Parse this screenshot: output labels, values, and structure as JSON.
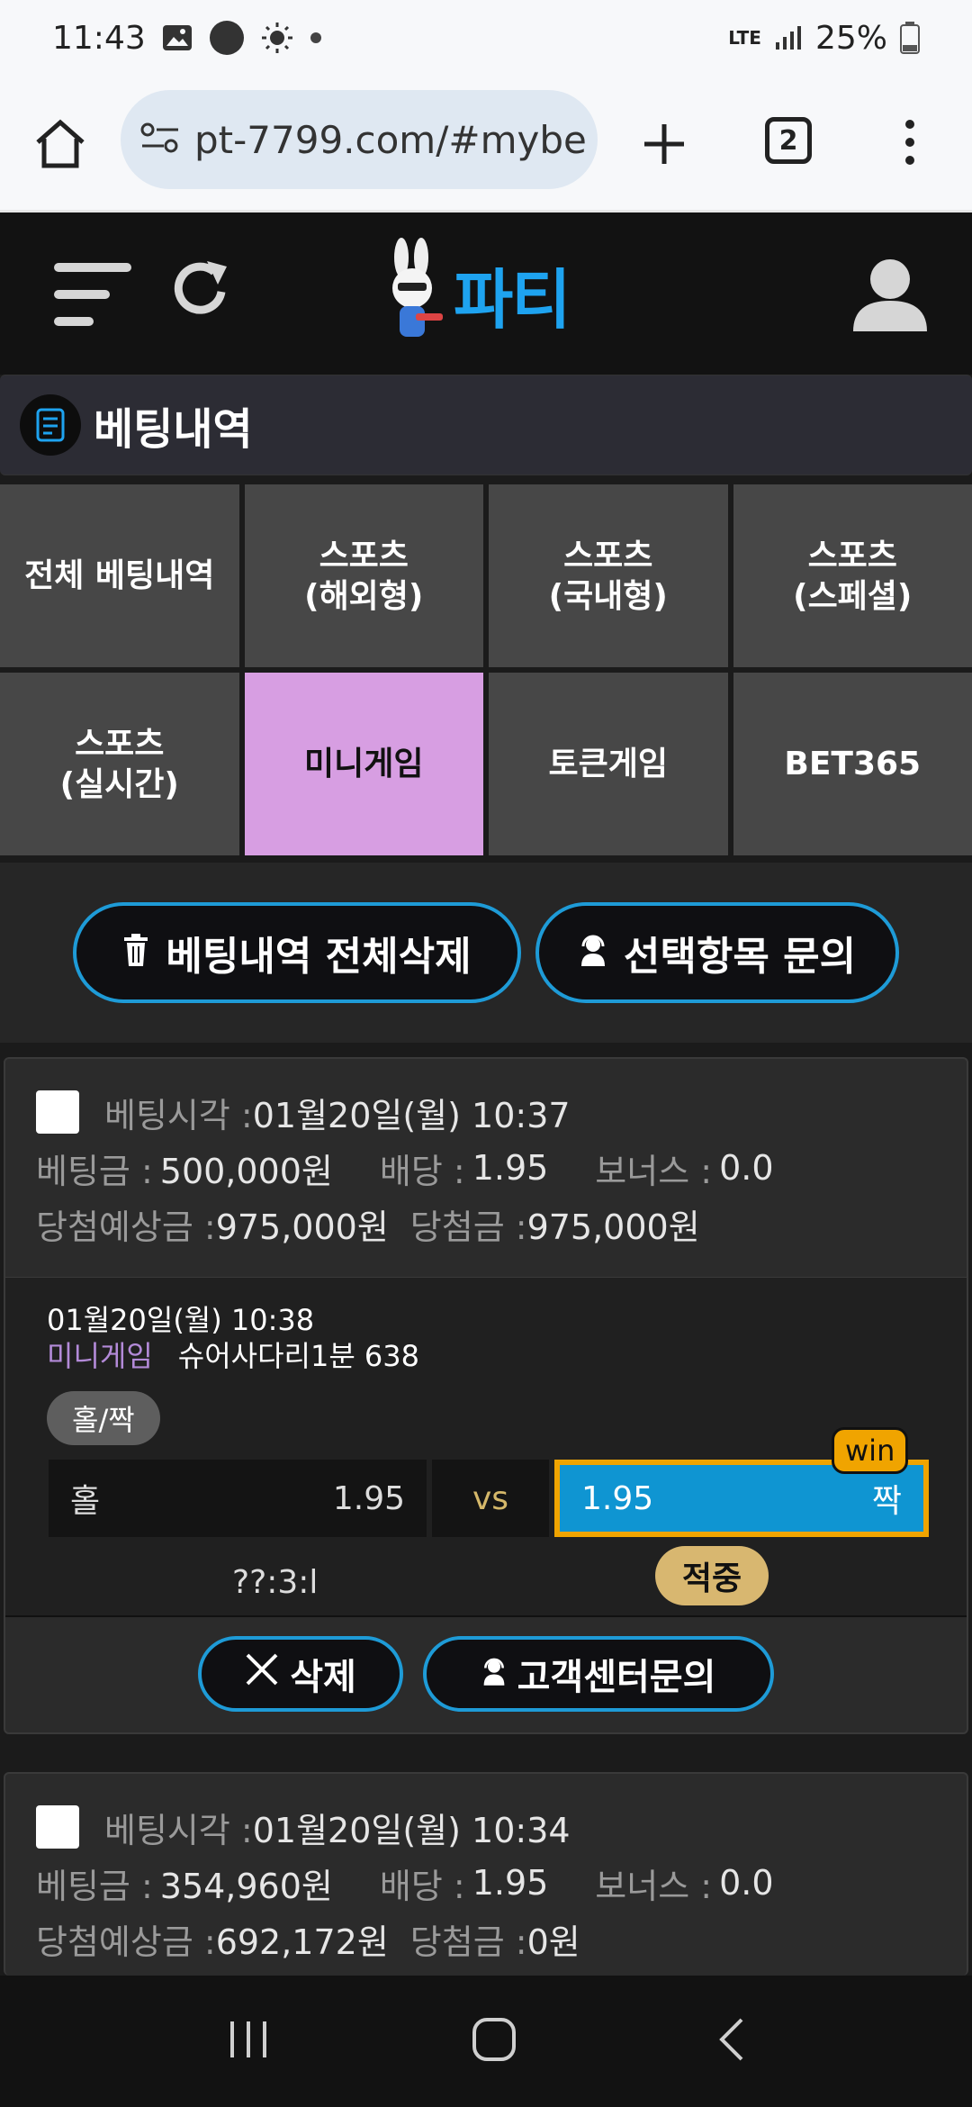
{
  "status_bar": {
    "time": "11:43",
    "notif_badge": "coupang eats",
    "network": "LTE",
    "battery": "25%"
  },
  "browser": {
    "url": "pt-7799.com/#mybe",
    "tab_count": "2"
  },
  "header": {
    "site_name": "파티"
  },
  "page": {
    "title": "베팅내역"
  },
  "tabs": [
    {
      "label": "전체 베팅내역",
      "active": false
    },
    {
      "label": "스포츠\n(해외형)",
      "active": false
    },
    {
      "label": "스포츠\n(국내형)",
      "active": false
    },
    {
      "label": "스포츠\n(스페셜)",
      "active": false
    },
    {
      "label": "스포츠\n(실시간)",
      "active": false
    },
    {
      "label": "미니게임",
      "active": true
    },
    {
      "label": "토큰게임",
      "active": false
    },
    {
      "label": "BET365",
      "active": false
    }
  ],
  "actions": {
    "delete_all_label": "베팅내역 전체삭제",
    "inquiry_selected_label": "선택항목 문의"
  },
  "bets": [
    {
      "bet_time_label": "베팅시각 :",
      "bet_time": "01월20일(월) 10:37",
      "amount_label": "베팅금 :",
      "amount": "500,000원",
      "odds_label": "배당 :",
      "odds": "1.95",
      "bonus_label": "보너스 :",
      "bonus": "0.0",
      "expected_label": "당첨예상금 :",
      "expected": "975,000원",
      "won_label": "당첨금 :",
      "won": "975,000원",
      "detail": {
        "datetime": "01월20일(월) 10:38",
        "category": "미니게임",
        "game": "슈어사다리1분 638",
        "market": "홀/짝",
        "home_label": "홀",
        "home_odds": "1.95",
        "vs": "vs",
        "away_odds": "1.95",
        "away_label": "짝",
        "win_badge": "win",
        "score": "??:3:l",
        "result": "적중"
      },
      "delete_label": "삭제",
      "support_label": "고객센터문의"
    },
    {
      "bet_time_label": "베팅시각 :",
      "bet_time": "01월20일(월) 10:34",
      "amount_label": "베팅금 :",
      "amount": "354,960원",
      "odds_label": "배당 :",
      "odds": "1.95",
      "bonus_label": "보너스 :",
      "bonus": "0.0",
      "expected_label": "당첨예상금 :",
      "expected": "692,172원",
      "won_label": "당첨금 :",
      "won": "0원"
    }
  ],
  "colors": {
    "accent_blue": "#1e9bd7",
    "active_tab": "#d79ee2",
    "win_gold": "#f0a400",
    "result_badge": "#d8b770"
  }
}
